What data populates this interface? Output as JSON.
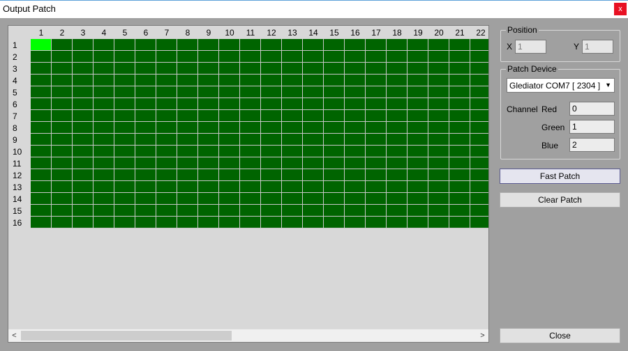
{
  "window": {
    "title": "Output Patch",
    "close_glyph": "x"
  },
  "grid": {
    "columns": [
      "1",
      "2",
      "3",
      "4",
      "5",
      "6",
      "7",
      "8",
      "9",
      "10",
      "11",
      "12",
      "13",
      "14",
      "15",
      "16",
      "17",
      "18",
      "19",
      "20",
      "21",
      "22"
    ],
    "rows": [
      "1",
      "2",
      "3",
      "4",
      "5",
      "6",
      "7",
      "8",
      "9",
      "10",
      "11",
      "12",
      "13",
      "14",
      "15",
      "16"
    ],
    "selected_cell": {
      "row": 1,
      "column": 1
    },
    "cell_color": "#006400",
    "selected_color": "#00ff00",
    "scroll": {
      "left_arrow": "<",
      "right_arrow": ">"
    }
  },
  "position": {
    "title": "Position",
    "x_label": "X",
    "x_value": "1",
    "y_label": "Y",
    "y_value": "1"
  },
  "patch_device": {
    "title": "Patch Device",
    "device": "Glediator COM7 [ 2304 ]",
    "channel_label": "Channel",
    "red_label": "Red",
    "red_value": "0",
    "green_label": "Green",
    "green_value": "1",
    "blue_label": "Blue",
    "blue_value": "2"
  },
  "buttons": {
    "fast_patch": "Fast Patch",
    "clear_patch": "Clear Patch",
    "close": "Close"
  }
}
